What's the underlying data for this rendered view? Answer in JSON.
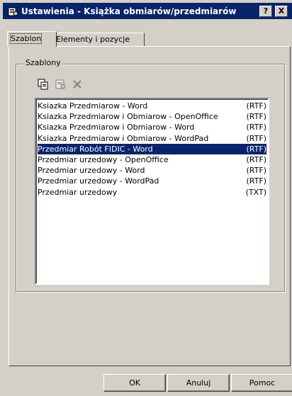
{
  "window": {
    "title": "Ustawienia - Książka obmiarów/przedmiarów",
    "help_label": "?",
    "close_label": "X"
  },
  "tabs": [
    {
      "label": "Szablon",
      "active": true
    },
    {
      "label": "Elementy i pozycje",
      "active": false
    }
  ],
  "group": {
    "label": "Szablony"
  },
  "toolbar": [
    "copy-icon",
    "properties-icon",
    "delete-icon"
  ],
  "templates": [
    {
      "name": "Ksiazka Przedmiarow - Word",
      "format": "(RTF)",
      "selected": false
    },
    {
      "name": "Ksiazka Przedmiarow i Obmiarow - OpenOffice",
      "format": "(RTF)",
      "selected": false
    },
    {
      "name": "Ksiazka Przedmiarow i Obmiarow - Word",
      "format": "(RTF)",
      "selected": false
    },
    {
      "name": "Ksiazka Przedmiarow i Obmiarow - WordPad",
      "format": "(RTF)",
      "selected": false
    },
    {
      "name": "Przedmiar Robót FIDIC - Word",
      "format": "(RTF)",
      "selected": true
    },
    {
      "name": "Przedmiar urzedowy - OpenOffice",
      "format": "(RTF)",
      "selected": false
    },
    {
      "name": "Przedmiar urzedowy - Word",
      "format": "(RTF)",
      "selected": false
    },
    {
      "name": "Przedmiar urzedowy - WordPad",
      "format": "(RTF)",
      "selected": false
    },
    {
      "name": "Przedmiar urzedowy",
      "format": "(TXT)",
      "selected": false
    }
  ],
  "buttons": {
    "ok": "OK",
    "cancel": "Anuluj",
    "help": "Pomoc"
  },
  "colors": {
    "titlebar": "#0a246a",
    "face": "#d4d0c8",
    "selection": "#0a246a"
  }
}
